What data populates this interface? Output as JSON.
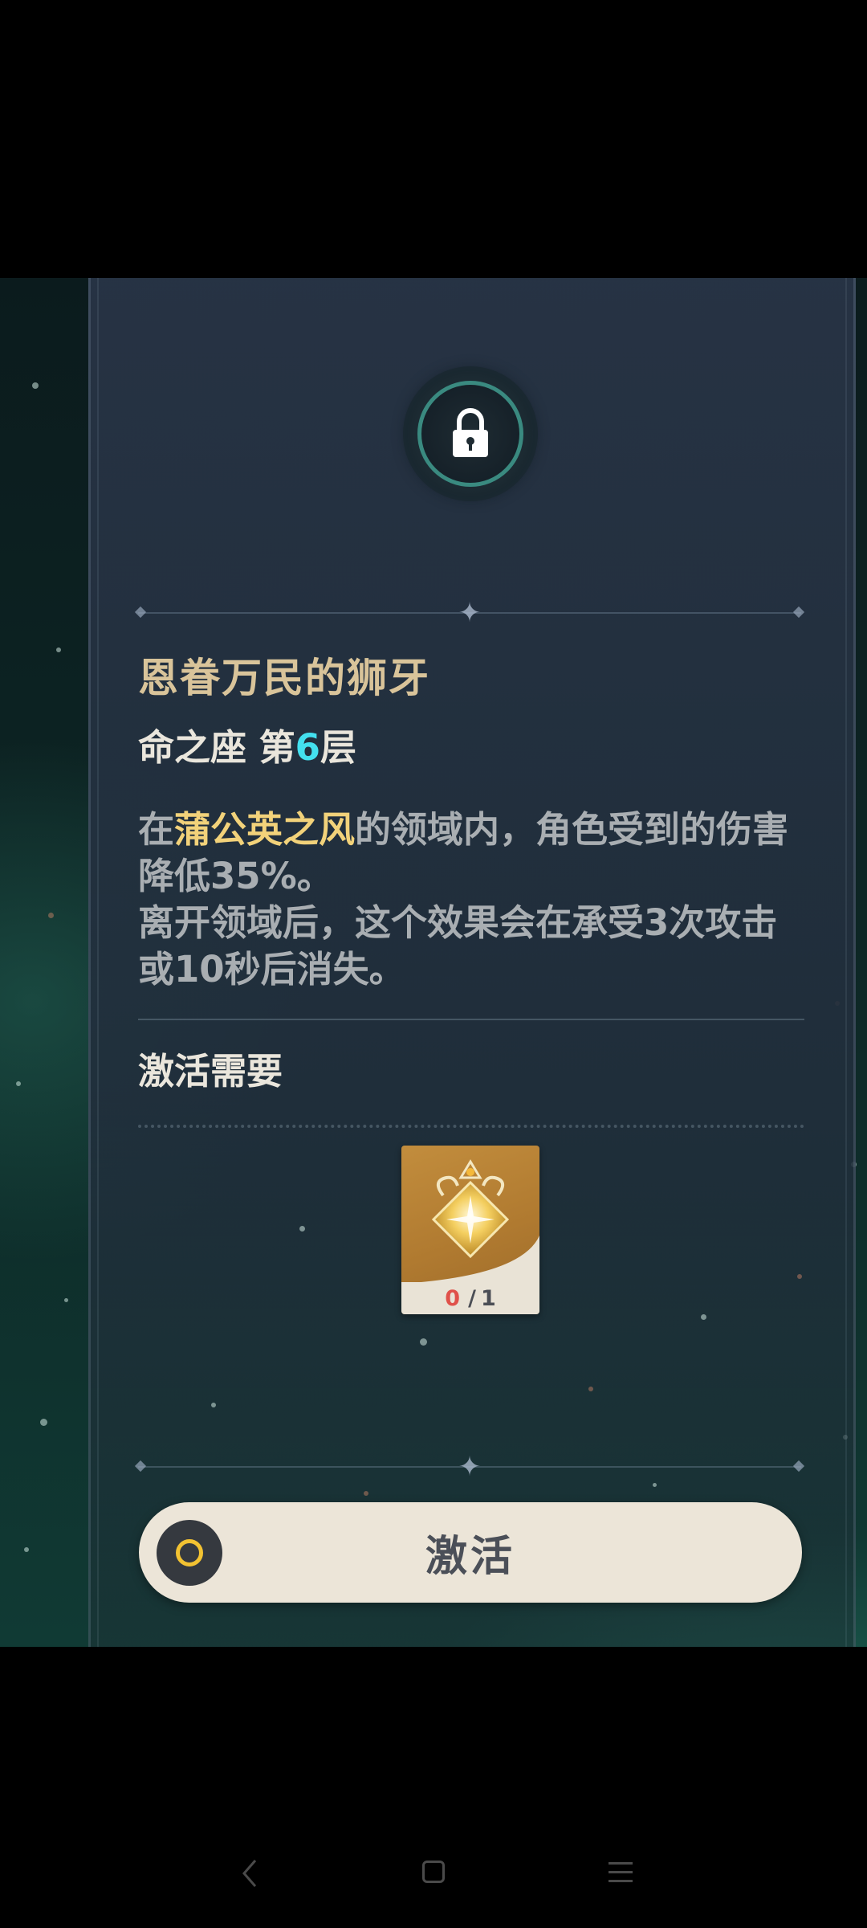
{
  "constellation": {
    "title": "恩眷万民的狮牙",
    "layer_prefix": "命之座 第",
    "layer_number": "6",
    "layer_suffix": "层",
    "lock_icon": "lock-icon"
  },
  "description": {
    "line1_pre": "在",
    "highlight": "蒲公英之风",
    "line1_post": "的领域内，角色受到的伤害降低35%。",
    "line2": "离开领域后，这个效果会在承受3次攻击或10秒后消失。",
    "highlight_color": "#f2d27a"
  },
  "requirement": {
    "heading": "激活需要",
    "item": {
      "icon": "star-crystal-icon",
      "have": "0",
      "need": "1",
      "separator": "/"
    }
  },
  "activate_button": {
    "label": "激活",
    "icon": "primogem-ring-icon"
  },
  "navigation": {
    "back": "back-icon",
    "home": "home-icon",
    "menu": "menu-icon"
  },
  "colors": {
    "title": "#d9c49a",
    "layer_number": "#43e0ef",
    "button_bg": "#ece5d8",
    "count_have": "#e0514a"
  }
}
